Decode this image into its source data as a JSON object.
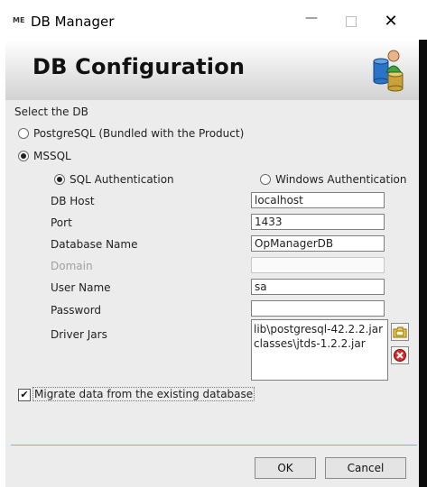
{
  "window": {
    "title": "DB Manager",
    "app_icon_text": "ME",
    "minimize_glyph": "—",
    "close_glyph": "✕"
  },
  "banner": {
    "title": "DB Configuration",
    "icon": "database-user-icon"
  },
  "form": {
    "select_db_label": "Select the DB",
    "db_options": [
      {
        "label": "PostgreSQL (Bundled with the Product)",
        "selected": false
      },
      {
        "label": "MSSQL",
        "selected": true
      }
    ],
    "auth_options": [
      {
        "label": "SQL Authentication",
        "selected": true
      },
      {
        "label": "Windows Authentication",
        "selected": false
      }
    ],
    "fields": {
      "db_host": {
        "label": "DB Host",
        "value": "localhost"
      },
      "port": {
        "label": "Port",
        "value": "1433"
      },
      "database_name": {
        "label": "Database Name",
        "value": "OpManagerDB"
      },
      "domain": {
        "label": "Domain",
        "value": "",
        "disabled": true
      },
      "user_name": {
        "label": "User Name",
        "value": "sa"
      },
      "password": {
        "label": "Password",
        "value": ""
      }
    },
    "driver_jars": {
      "label": "Driver Jars",
      "items": [
        "lib\\postgresql-42.2.2.jar",
        "classes\\jtds-1.2.2.jar"
      ],
      "add_icon": "folder-add-icon",
      "remove_icon": "remove-icon"
    },
    "migrate": {
      "label": "Migrate data from the existing database",
      "checked": true,
      "check_glyph": "✔"
    }
  },
  "buttons": {
    "ok": "OK",
    "cancel": "Cancel"
  }
}
